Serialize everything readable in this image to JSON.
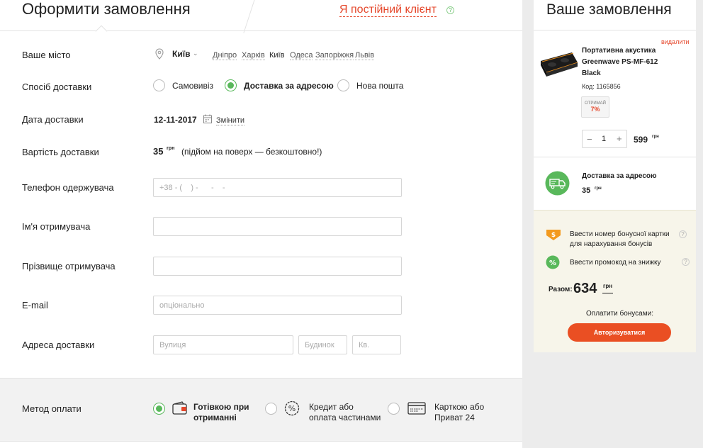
{
  "header": {
    "title": "Оформити замовлення",
    "regular_client": "Я постійний клієнт",
    "help": "?"
  },
  "city": {
    "label": "Ваше місто",
    "current": "Київ",
    "options": [
      "Дніпро",
      "Харків",
      "Київ",
      "Одеса",
      "Запоріжжя",
      "Львів"
    ]
  },
  "delivery": {
    "label": "Спосіб доставки",
    "options": [
      "Самовивіз",
      "Доставка за адресою",
      "Нова пошта"
    ],
    "selected": "Доставка за адресою"
  },
  "date": {
    "label": "Дата доставки",
    "value": "12-11-2017",
    "change": "Змінити"
  },
  "cost": {
    "label": "Вартість доставки",
    "value": "35",
    "currency": "грн",
    "note": "(підйом на поверх — безкоштовно!)"
  },
  "phone": {
    "label": "Телефон одержувача",
    "placeholder": "+38 - (    ) -      -    -"
  },
  "first_name": {
    "label": "Ім'я отримувача",
    "value": ""
  },
  "last_name": {
    "label": "Прізвище отримувача",
    "value": ""
  },
  "email": {
    "label": "E-mail",
    "placeholder": "опціонально"
  },
  "address": {
    "label": "Адреса доставки",
    "street_placeholder": "Вулиця",
    "house_placeholder": "Будинок",
    "apt_placeholder": "Кв."
  },
  "payment": {
    "label": "Метод оплати",
    "options": [
      {
        "line1": "Готівкою при",
        "line2": "отриманні",
        "icon": "wallet-icon"
      },
      {
        "line1": "Кредит або",
        "line2": "оплата частинами",
        "icon": "percent-icon"
      },
      {
        "line1": "Карткою або",
        "line2": "Приват 24",
        "icon": "card-icon"
      }
    ],
    "selected": 0
  },
  "order": {
    "title": "Ваше замовлення",
    "remove": "видалити",
    "product": {
      "name": "Портативна акустика Greenwave PS-MF-612 Black",
      "code": "Код: 1165856",
      "bonus_top": "ОТРИМАЙ",
      "bonus_value": "7%",
      "quantity": "1",
      "minus": "−",
      "plus": "+",
      "price": "599",
      "currency": "грн"
    },
    "delivery": {
      "method": "Доставка за адресою",
      "price": "35",
      "currency": "грн"
    },
    "bonus_card": "Ввести номер бонусної картки для нарахування бонусів",
    "promo": "Ввести промокод на знижку",
    "total_label": "Разом:",
    "total_value": "634",
    "total_currency": "грн",
    "pay_bonus_label": "Оплатити бонусами:",
    "login_button": "Авторизуватися"
  },
  "colors": {
    "accent": "#e5472b",
    "green": "#59b85b",
    "button": "#ea4f23",
    "summary_bg": "#f7f5ea"
  }
}
